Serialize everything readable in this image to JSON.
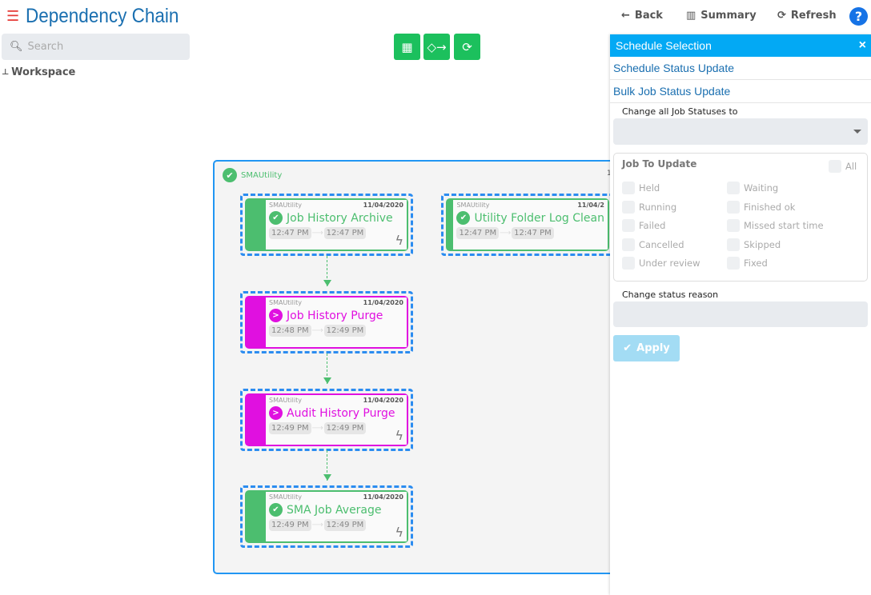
{
  "header": {
    "title": "Dependency Chain",
    "menu_icon": "hamburger-icon"
  },
  "sidebar": {
    "search_placeholder": "Search",
    "workspace_label": "Workspace"
  },
  "toolbar": {
    "buttons": [
      "grid-layout-icon",
      "flow-icon",
      "refresh-icon"
    ],
    "color": "#1cc05d"
  },
  "topnav": {
    "back": "Back",
    "summary": "Summary",
    "refresh": "Refresh",
    "help": "?"
  },
  "canvas": {
    "group_name": "SMAUtility",
    "group_extra": "1",
    "jobs": [
      {
        "schedule": "SMAUtility",
        "date": "11/04/2020",
        "name": "Job History Archive",
        "start": "12:47 PM",
        "end": "12:47 PM",
        "status": "finished",
        "color": "#4cbe6f",
        "bolt": true
      },
      {
        "schedule": "SMAUtility",
        "date": "11/04/2",
        "name": "Utility Folder Log Clean",
        "start": "12:47 PM",
        "end": "12:47 PM",
        "status": "finished",
        "color": "#4cbe6f",
        "bolt": false
      },
      {
        "schedule": "SMAUtility",
        "date": "11/04/2020",
        "name": "Job History Purge",
        "start": "12:48 PM",
        "end": "12:49 PM",
        "status": "running",
        "color": "#e010e0",
        "bolt": false
      },
      {
        "schedule": "SMAUtility",
        "date": "11/04/2020",
        "name": "Audit History Purge",
        "start": "12:49 PM",
        "end": "12:49 PM",
        "status": "running",
        "color": "#e010e0",
        "bolt": true
      },
      {
        "schedule": "SMAUtility",
        "date": "11/04/2020",
        "name": "SMA Job Average",
        "start": "12:49 PM",
        "end": "12:49 PM",
        "status": "finished",
        "color": "#4cbe6f",
        "bolt": true
      }
    ]
  },
  "panel": {
    "title": "Schedule Selection",
    "close": "×",
    "link1": "Schedule Status Update",
    "link2": "Bulk Job Status Update",
    "change_all_label": "Change all Job Statuses to",
    "job_to_update": "Job To Update",
    "all": "All",
    "options_left": [
      "Held",
      "Running",
      "Failed",
      "Cancelled",
      "Under review"
    ],
    "options_right": [
      "Waiting",
      "Finished ok",
      "Missed start time",
      "Skipped",
      "Fixed"
    ],
    "reason_label": "Change status reason",
    "apply": "Apply"
  }
}
